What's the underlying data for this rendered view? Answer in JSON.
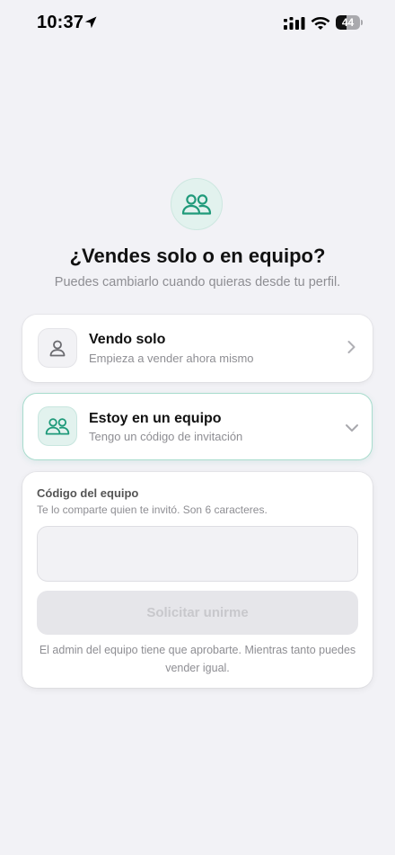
{
  "status_bar": {
    "time": "10:37",
    "battery_level": "44",
    "battery_fraction": 0.44
  },
  "header": {
    "icon": "people-icon",
    "title": "¿Vendes solo o en equipo?",
    "subtitle": "Puedes cambiarlo cuando quieras desde tu perfil."
  },
  "options": [
    {
      "title": "Vendo solo",
      "subtitle": "Empieza a vender ahora mismo",
      "icon": "person-icon",
      "indicator": "chevron-right-icon",
      "selected": false
    },
    {
      "title": "Estoy en un equipo",
      "subtitle": "Tengo un código de invitación",
      "icon": "people-icon",
      "indicator": "chevron-down-icon",
      "selected": true
    }
  ],
  "team_form": {
    "label": "Código del equipo",
    "help": "Te lo comparte quien te invitó. Son 6 caracteres.",
    "input_value": "",
    "button_label": "Solicitar unirme",
    "button_enabled": false,
    "note": "El admin del equipo tiene que aprobarte. Mientras tanto puedes vender igual."
  },
  "colors": {
    "accent": "#1f9a7a",
    "accent_soft": "#e2f2ee",
    "background": "#f2f2f6",
    "muted_text": "#8e8e93"
  }
}
